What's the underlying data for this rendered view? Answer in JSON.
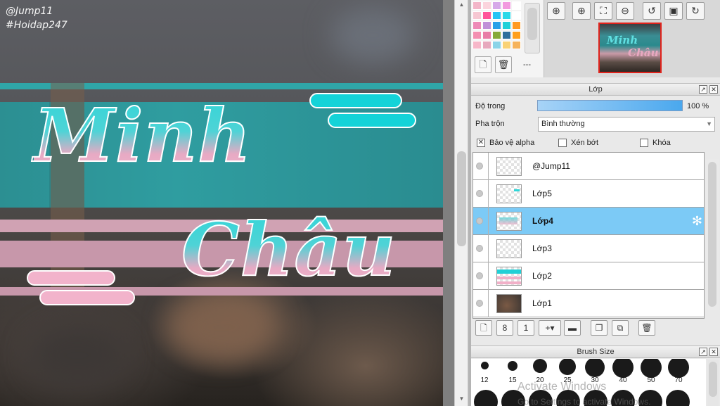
{
  "canvas": {
    "watermark_user": "@Jump11",
    "watermark_tag": "#Hoidap247",
    "text_line1": "Minh",
    "text_line2": "Châu"
  },
  "navigator": {
    "thumb_line1": "Minh",
    "thumb_line2": "Châu",
    "buttons": [
      "zoom-actual-icon",
      "zoom-in-icon",
      "fit-icon",
      "zoom-out-icon",
      "rotate-left-icon",
      "fullscreen-icon",
      "rotate-right-icon"
    ]
  },
  "palette": {
    "more_label": "---",
    "colors": [
      "#f3b6c9",
      "#fbd4dd",
      "#d6a9e9",
      "#f29adf",
      "#ffffff",
      "#f6c7d2",
      "#ff5599",
      "#26c4f4",
      "#2bd9e8",
      "#ffffff",
      "#ee8ab7",
      "#c08fd8",
      "#27a0e8",
      "#1fd0d8",
      "#ff9a22",
      "#f48fb1",
      "#e87ca6",
      "#86a939",
      "#2e6f9c",
      "#ff9f1c",
      "#f7b7c9",
      "#e7a8bd",
      "#8bd4e8",
      "#f9d276",
      "#f6b35a"
    ]
  },
  "layer_panel": {
    "title": "Lớp",
    "opacity_label": "Độ trong",
    "opacity_value": "100 %",
    "opacity_fraction": 1.0,
    "blend_label": "Pha trộn",
    "blend_value": "Bình thường",
    "protect_alpha_label": "Bảo vệ alpha",
    "protect_alpha_checked": true,
    "clipping_label": "Xén bớt",
    "clipping_checked": false,
    "lock_label": "Khóa",
    "lock_checked": false,
    "layers": [
      {
        "name": "@Jump11",
        "selected": false
      },
      {
        "name": "Lớp5",
        "selected": false
      },
      {
        "name": "Lớp4",
        "selected": true
      },
      {
        "name": "Lớp3",
        "selected": false
      },
      {
        "name": "Lớp2",
        "selected": false
      },
      {
        "name": "Lớp1",
        "selected": false
      }
    ]
  },
  "brush_panel": {
    "title": "Brush Size",
    "sizes": [
      "12",
      "15",
      "20",
      "25",
      "30",
      "40",
      "50",
      "70"
    ]
  },
  "os_overlay": {
    "line1": "Activate Windows",
    "line2": "Go to Settings to activate Windows."
  }
}
